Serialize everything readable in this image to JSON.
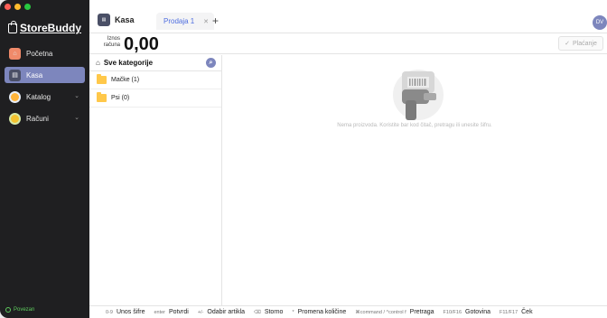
{
  "colors": {
    "accent": "#7d86bd",
    "sidebar_bg": "#1f1f21",
    "success": "#5ecb5e",
    "tab_text": "#4f6ee0",
    "folder": "#ffc84a"
  },
  "app": {
    "brand": "StoreBuddy",
    "connection_status": "Povezan"
  },
  "sidebar": {
    "items": [
      {
        "label": "Početna",
        "icon": "home-app-icon",
        "active": false,
        "expandable": false
      },
      {
        "label": "Kasa",
        "icon": "register-app-icon",
        "active": true,
        "expandable": false
      },
      {
        "label": "Katalog",
        "icon": "catalog-app-icon",
        "active": false,
        "expandable": true
      },
      {
        "label": "Računi",
        "icon": "receipts-app-icon",
        "active": false,
        "expandable": true
      }
    ]
  },
  "header": {
    "title": "Kasa",
    "tabs": [
      {
        "label": "Prodaja 1"
      }
    ],
    "add_tab": "+",
    "avatar_initials": "DV"
  },
  "amount": {
    "label": "Iznos računa",
    "value": "0,00",
    "pay_button": "Plaćanje"
  },
  "categories": {
    "header": "Sve kategorije",
    "items": [
      {
        "label": "Mačke (1)"
      },
      {
        "label": "Psi (0)"
      }
    ]
  },
  "products": {
    "empty_message": "Nema proizvoda. Koristite bar kod čitač, pretragu ili unesite šifru."
  },
  "shortcuts": [
    {
      "key": "0-9",
      "label": "Unos šifre"
    },
    {
      "key": "enter",
      "label": "Potvrdi"
    },
    {
      "key": "+/-",
      "label": "Odabir artikla"
    },
    {
      "key": "⌫",
      "label": "Storno"
    },
    {
      "key": "*",
      "label": "Promena količine"
    },
    {
      "key": "⌘command / ^control f",
      "label": "Pretraga"
    },
    {
      "key": "F10/F16",
      "label": "Gotovina"
    },
    {
      "key": "F11/F17",
      "label": "Ček"
    }
  ]
}
